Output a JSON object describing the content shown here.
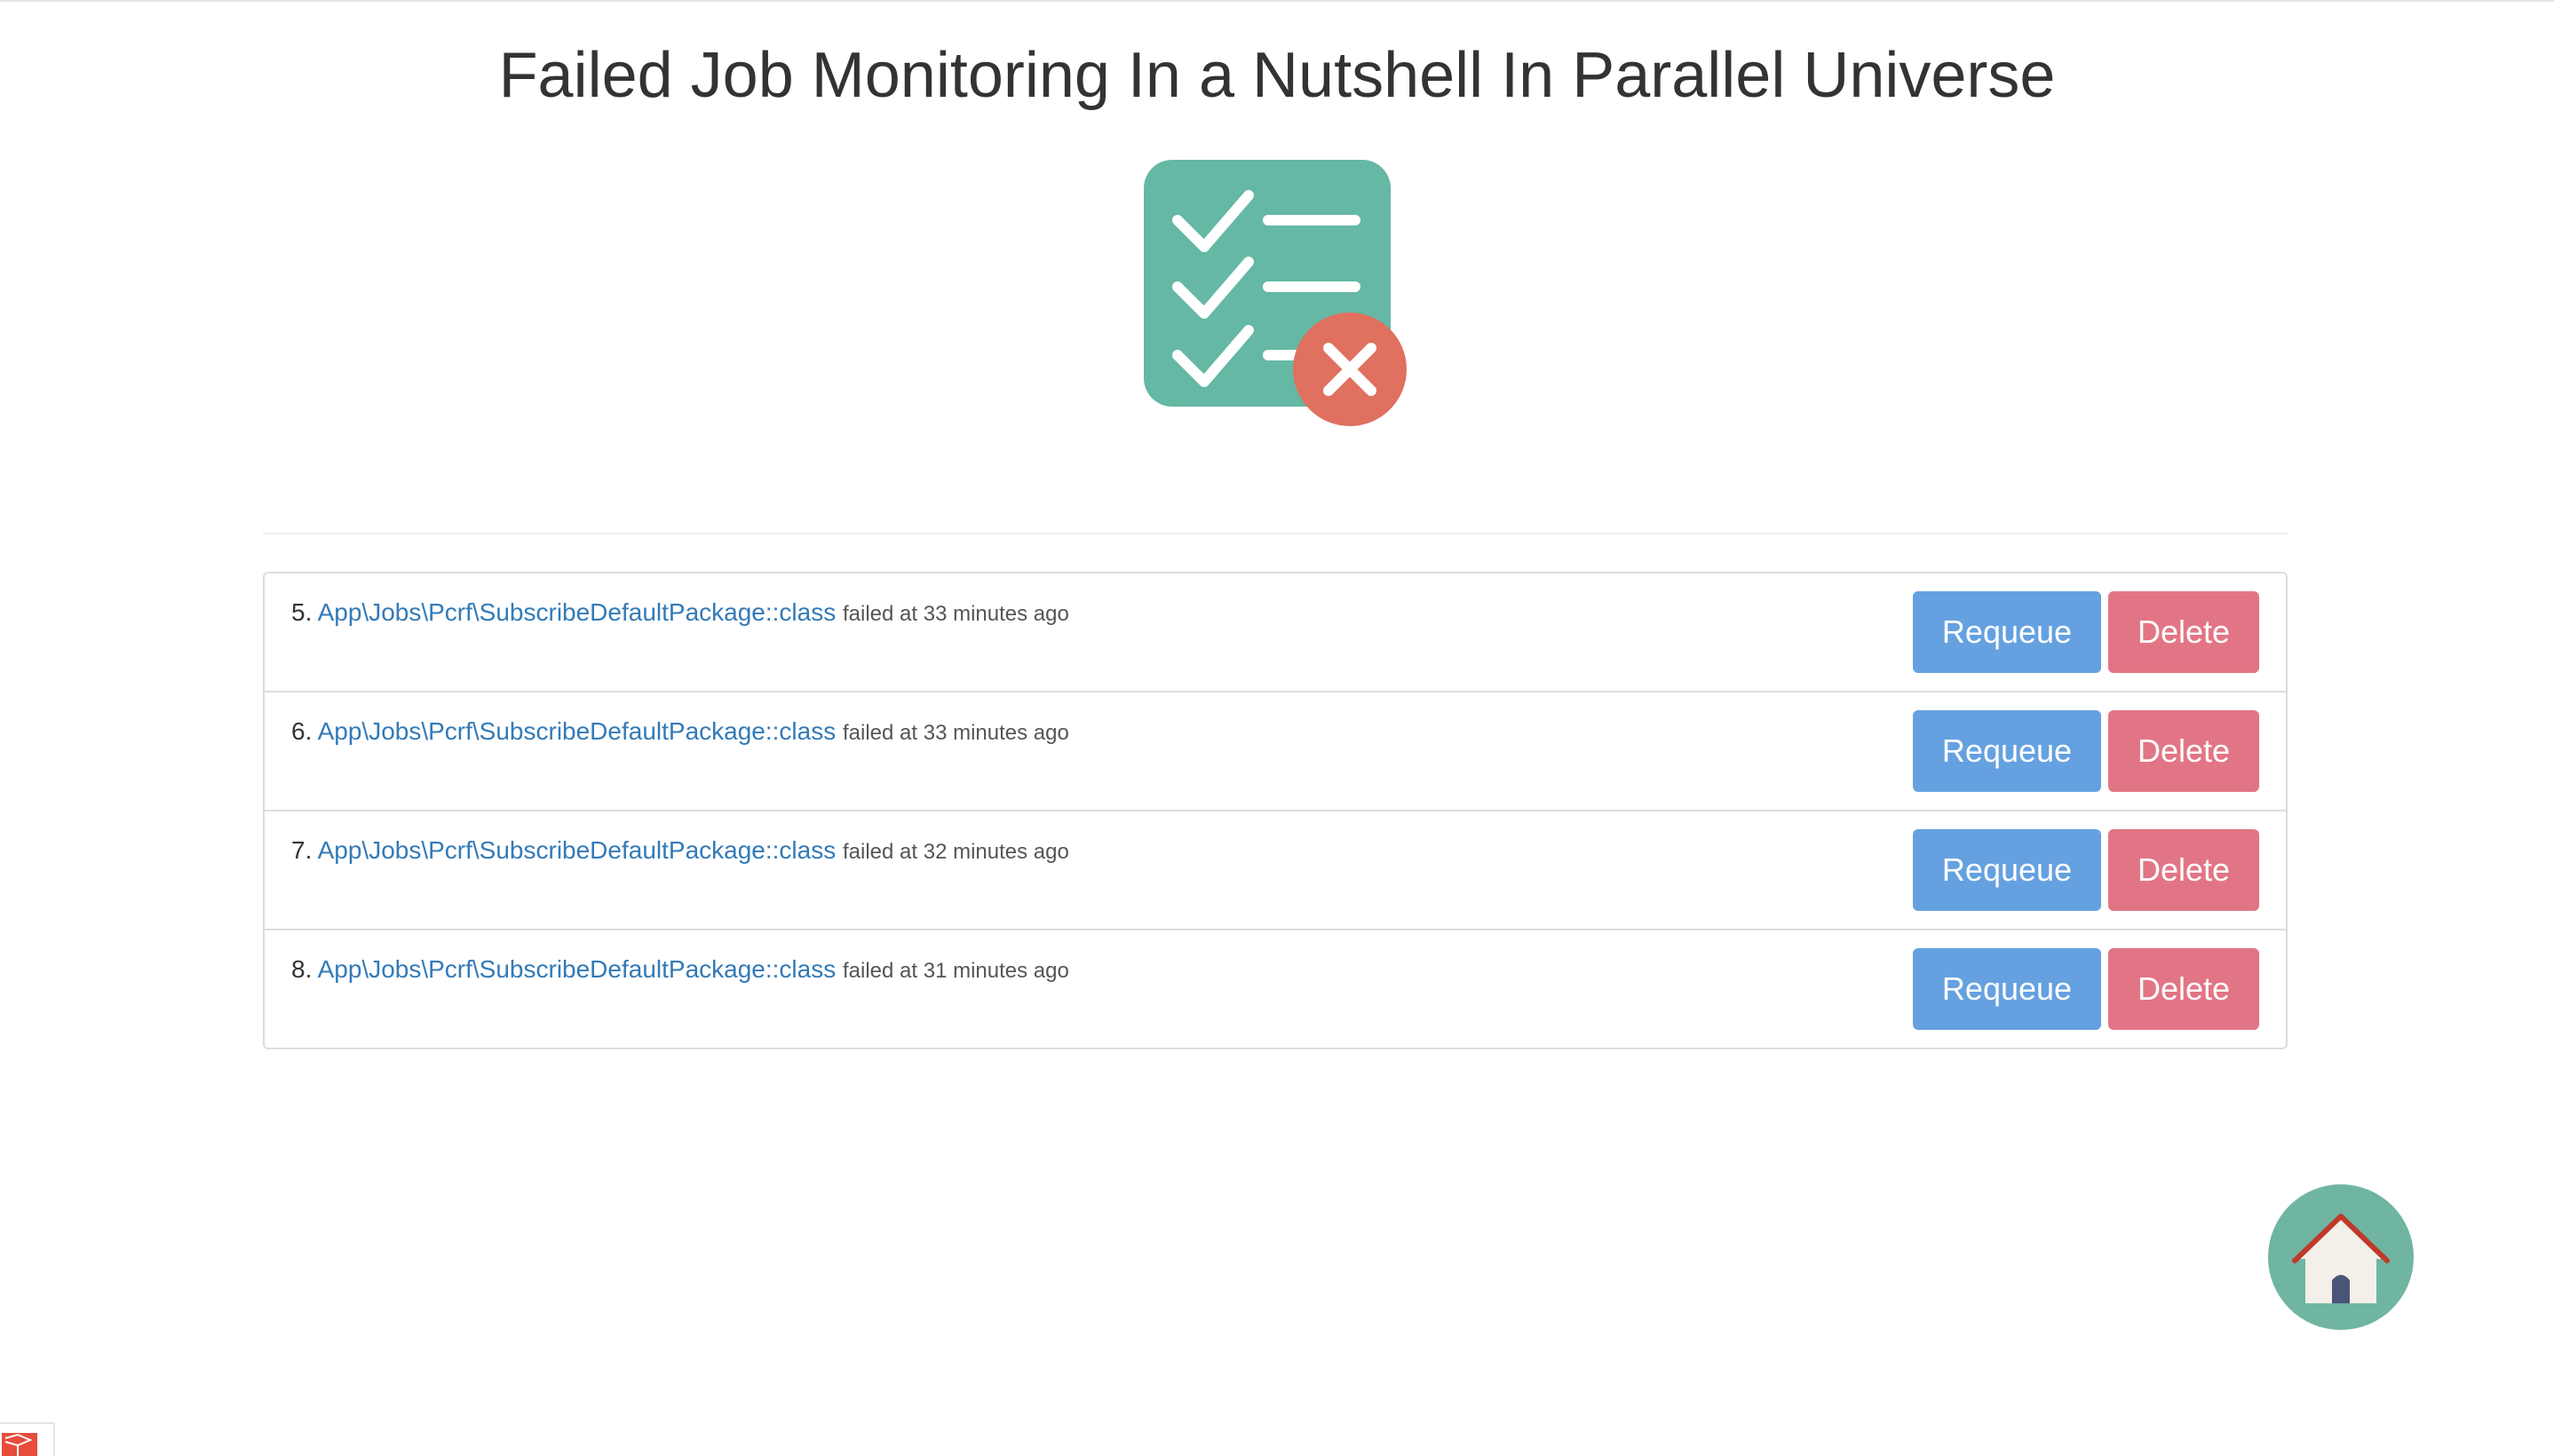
{
  "page": {
    "title": "Failed Job Monitoring In a Nutshell In Parallel Universe"
  },
  "icons": {
    "hero": "checklist-failed-icon",
    "home": "home-icon",
    "corner": "laravel-logo-icon"
  },
  "colors": {
    "checklist_bg": "#64b8a4",
    "fail_circle": "#e0705f",
    "link": "#337ab7",
    "requeue": "#65a1e0",
    "delete": "#e27585",
    "home_bg": "#6fb5a2"
  },
  "jobs": [
    {
      "index": "5.",
      "class_name": "App\\Jobs\\Pcrf\\SubscribeDefaultPackage::class",
      "meta": "failed at 33 minutes ago",
      "requeue_label": "Requeue",
      "delete_label": "Delete"
    },
    {
      "index": "6.",
      "class_name": "App\\Jobs\\Pcrf\\SubscribeDefaultPackage::class",
      "meta": "failed at 33 minutes ago",
      "requeue_label": "Requeue",
      "delete_label": "Delete"
    },
    {
      "index": "7.",
      "class_name": "App\\Jobs\\Pcrf\\SubscribeDefaultPackage::class",
      "meta": "failed at 32 minutes ago",
      "requeue_label": "Requeue",
      "delete_label": "Delete"
    },
    {
      "index": "8.",
      "class_name": "App\\Jobs\\Pcrf\\SubscribeDefaultPackage::class",
      "meta": "failed at 31 minutes ago",
      "requeue_label": "Requeue",
      "delete_label": "Delete"
    }
  ]
}
